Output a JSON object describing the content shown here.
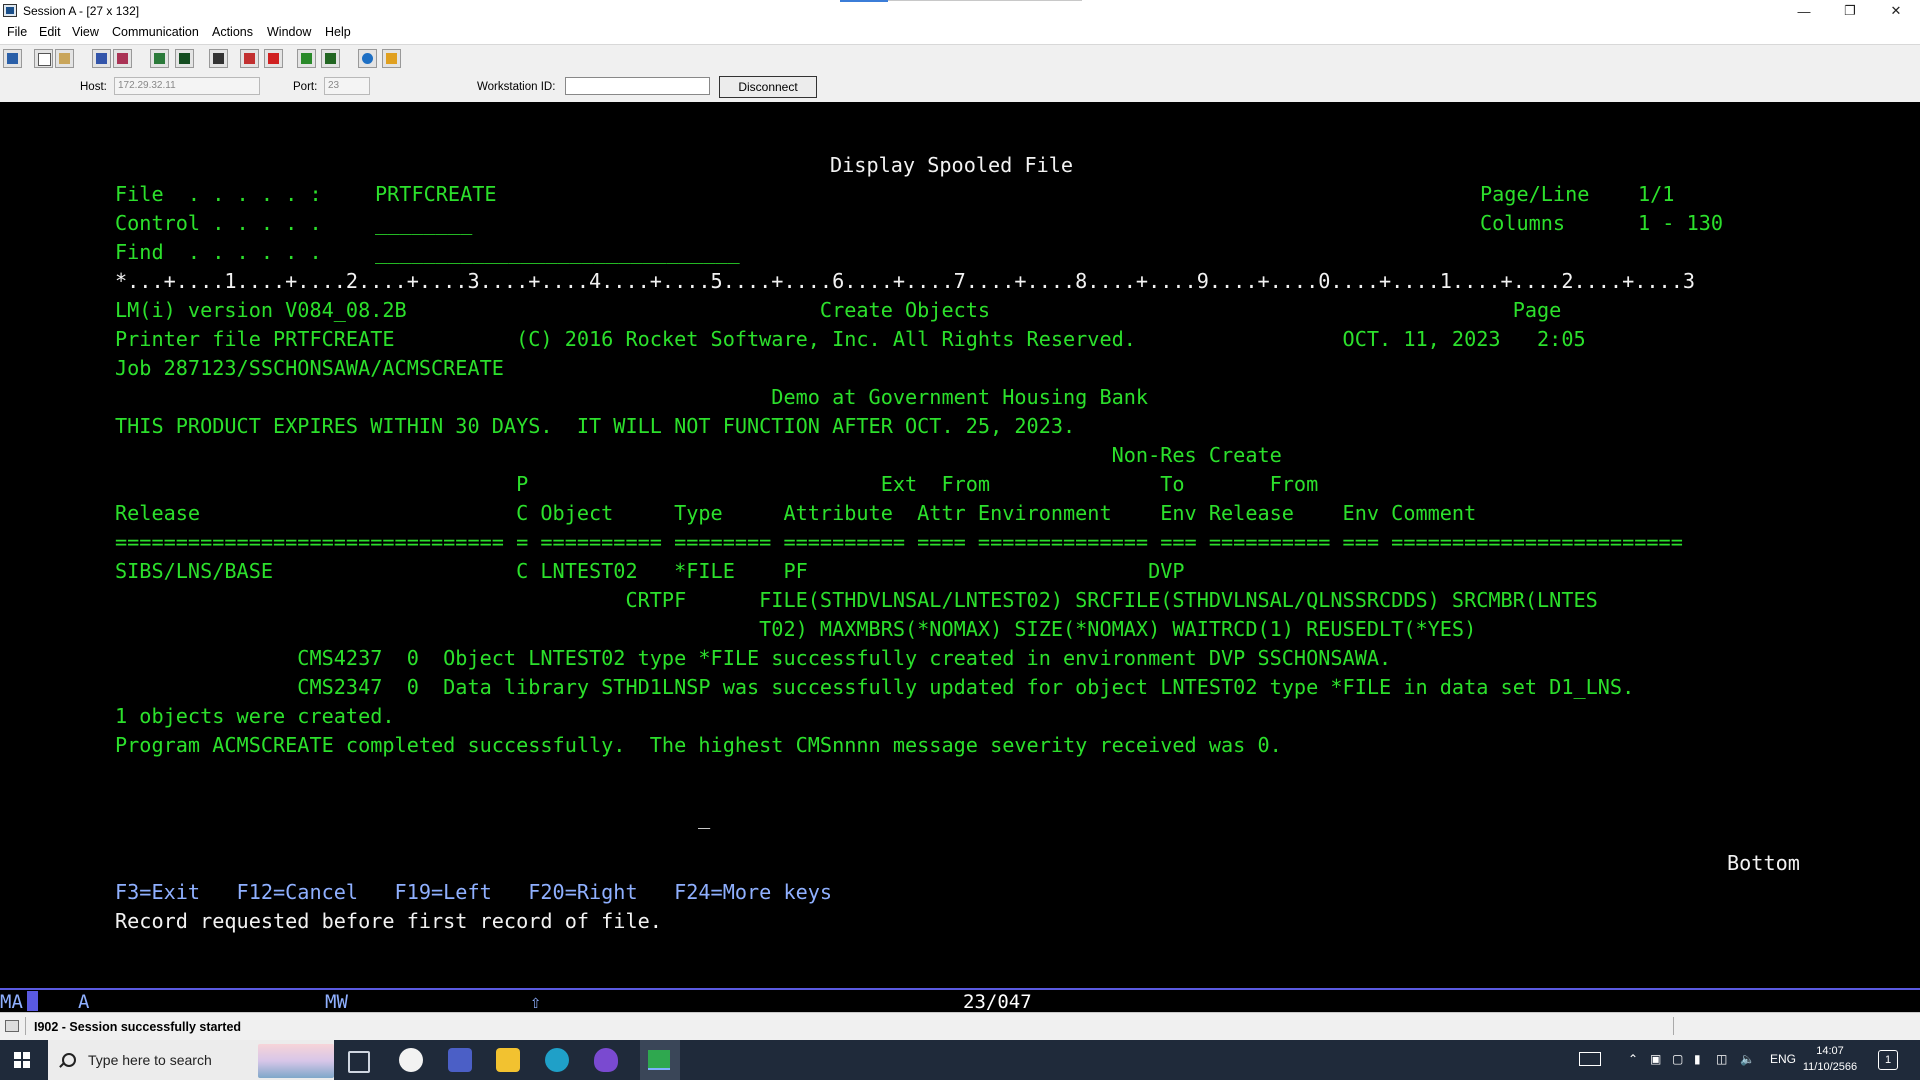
{
  "window": {
    "title": "Session A - [27 x 132]"
  },
  "menu": {
    "items": [
      "File",
      "Edit",
      "View",
      "Communication",
      "Actions",
      "Window",
      "Help"
    ]
  },
  "toolbar": {
    "icons": [
      "print-screen-icon",
      "copy-icon",
      "paste-icon",
      "send-icon",
      "receive-icon",
      "display-icon",
      "keypad-icon",
      "macro-icon",
      "record-icon",
      "stop-icon",
      "play-icon",
      "transfer-icon",
      "globe-icon",
      "clipboard-icon"
    ]
  },
  "connection": {
    "host_label": "Host:",
    "host_value": "172.29.32.11",
    "port_label": "Port:",
    "port_value": "23",
    "workstation_label": "Workstation ID:",
    "workstation_value": "",
    "disconnect_label": "Disconnect"
  },
  "screen": {
    "title": "Display Spooled File",
    "file_label": "File  . . . . . :",
    "file_value": "PRTFCREATE",
    "control_label": "Control . . . . .",
    "control_value": "________",
    "find_label": "Find  . . . . . .",
    "find_value": "______________________________",
    "pageline_label": "Page/Line",
    "pageline_value": "1/1",
    "columns_label": "Columns",
    "columns_value": "1 - 130",
    "ruler": "*...+....1....+....2....+....3....+....4....+....5....+....6....+....7....+....8....+....9....+....0....+....1....+....2....+....3",
    "lines": [
      "LM(i) version V084_08.2B                                  Create Objects                                           Page",
      "Printer file PRTFCREATE          (C) 2016 Rocket Software, Inc. All Rights Reserved.                 OCT. 11, 2023   2:05",
      "Job 287123/SSCHONSAWA/ACMSCREATE",
      "                                                      Demo at Government Housing Bank",
      "THIS PRODUCT EXPIRES WITHIN 30 DAYS.  IT WILL NOT FUNCTION AFTER OCT. 25, 2023.",
      "                                                                                  Non-Res Create",
      "                                 P                             Ext  From              To       From",
      "Release                          C Object     Type     Attribute  Attr Environment    Env Release    Env Comment",
      "================================ = ========== ======== ========== ==== ============== === ========== === ========================",
      "SIBS/LNS/BASE                    C LNTEST02   *FILE    PF                            DVP",
      "                                          CRTPF      FILE(STHDVLNSAL/LNTEST02) SRCFILE(STHDVLNSAL/QLNSSRCDDS) SRCMBR(LNTES",
      "                                                     T02) MAXMBRS(*NOMAX) SIZE(*NOMAX) WAITRCD(1) REUSEDLT(*YES)",
      "               CMS4237  0  Object LNTEST02 type *FILE successfully created in environment DVP SSCHONSAWA.",
      "               CMS2347  0  Data library STHD1LNSP was successfully updated for object LNTEST02 type *FILE in data set D1_LNS.",
      "1 objects were created.",
      "Program ACMSCREATE completed successfully.  The highest CMSnnnn message severity received was 0."
    ],
    "cursor_char": "_",
    "bottom_indicator": "Bottom",
    "function_keys": "F3=Exit   F12=Cancel   F19=Left   F20=Right   F24=More keys",
    "message": "Record requested before first record of file."
  },
  "oia": {
    "mode": "MA",
    "session": "A",
    "mw": "MW",
    "shift": "⇧",
    "cursor_pos": "23/047"
  },
  "status": {
    "message": "I902 - Session successfully started"
  },
  "taskbar": {
    "search_placeholder": "Type here to search",
    "language": "ENG",
    "time": "14:07",
    "date": "11/10/2566",
    "notification_count": "1"
  }
}
